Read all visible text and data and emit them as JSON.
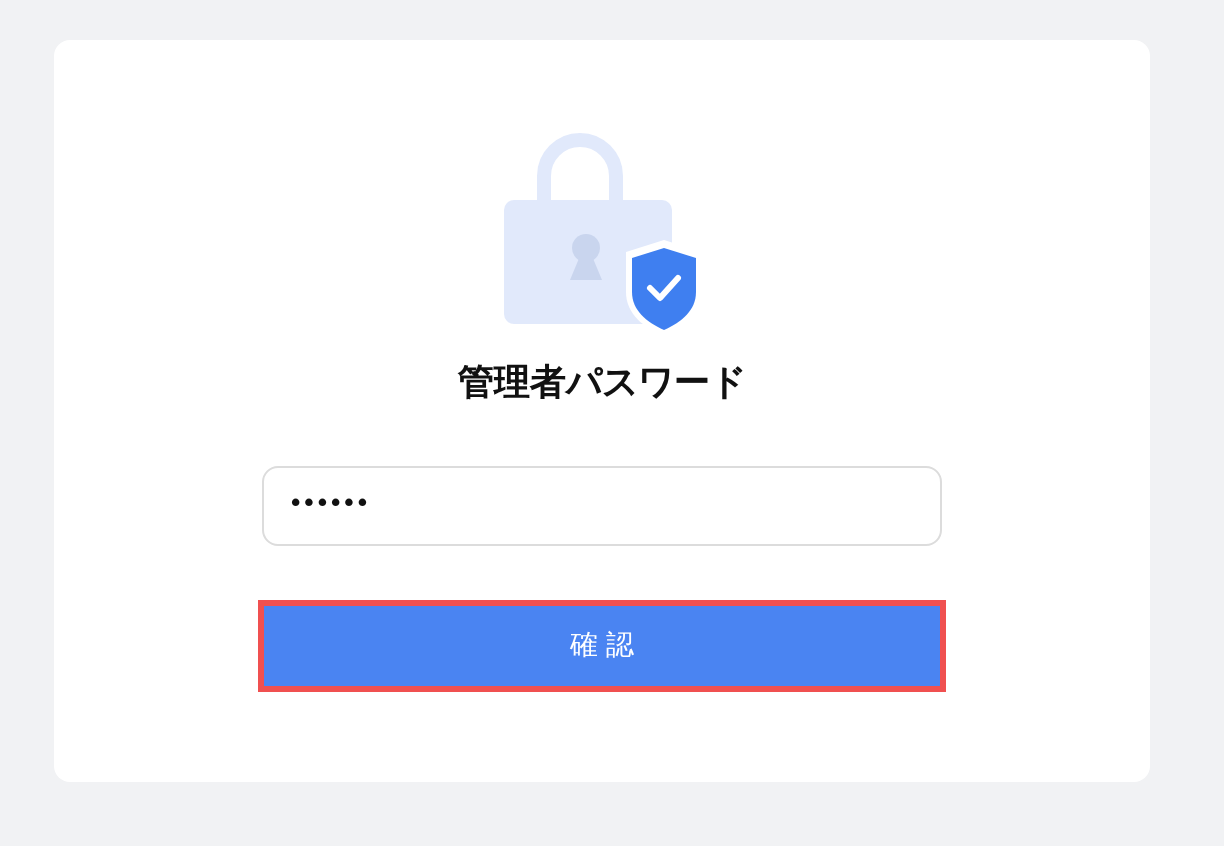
{
  "title": "管理者パスワード",
  "password_field": {
    "value": "••••••"
  },
  "confirm_button": {
    "label": "確 認",
    "highlighted": true
  }
}
